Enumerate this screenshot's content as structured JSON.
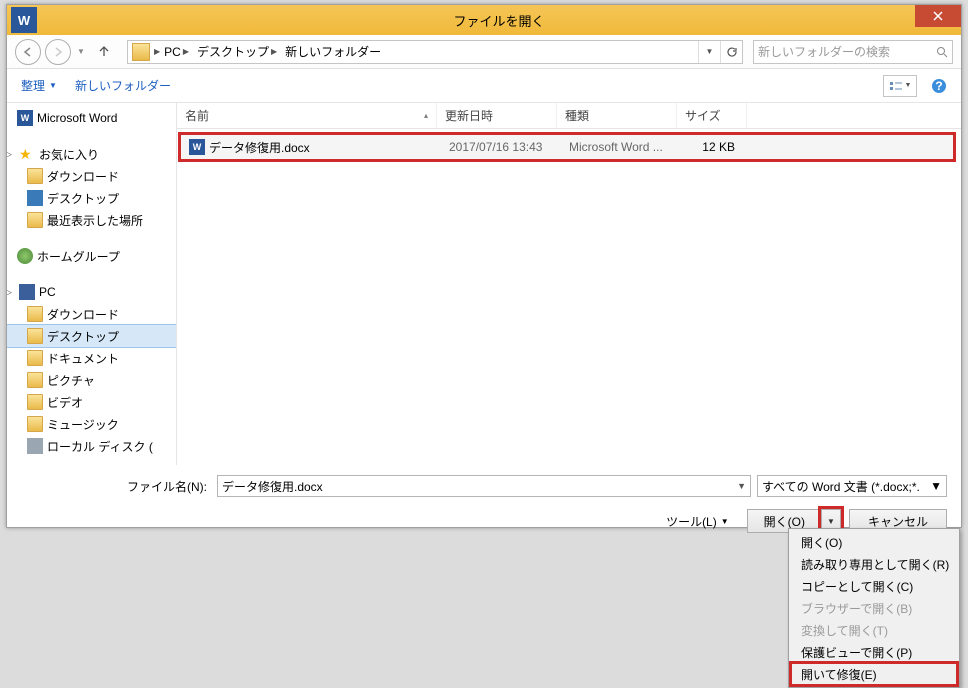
{
  "title": "ファイルを開く",
  "breadcrumb": [
    "PC",
    "デスクトップ",
    "新しいフォルダー"
  ],
  "search_placeholder": "新しいフォルダーの検索",
  "toolbar": {
    "organize": "整理",
    "new_folder": "新しいフォルダー"
  },
  "columns": {
    "name": "名前",
    "date": "更新日時",
    "type": "種類",
    "size": "サイズ"
  },
  "sidebar": {
    "word": "Microsoft Word",
    "fav": "お気に入り",
    "fav_items": [
      "ダウンロード",
      "デスクトップ",
      "最近表示した場所"
    ],
    "homegroup": "ホームグループ",
    "pc": "PC",
    "pc_items": [
      "ダウンロード",
      "デスクトップ",
      "ドキュメント",
      "ピクチャ",
      "ビデオ",
      "ミュージック",
      "ローカル ディスク ("
    ]
  },
  "file": {
    "name": "データ修復用.docx",
    "date": "2017/07/16 13:43",
    "type": "Microsoft Word ...",
    "size": "12 KB"
  },
  "footer": {
    "fn_label": "ファイル名(N):",
    "fn_value": "データ修復用.docx",
    "filter": "すべての Word 文書 (*.docx;*.",
    "tools": "ツール(L)",
    "open": "開く(O)",
    "cancel": "キャンセル"
  },
  "dropdown": [
    {
      "label": "開く(O)",
      "disabled": false
    },
    {
      "label": "読み取り専用として開く(R)",
      "disabled": false
    },
    {
      "label": "コピーとして開く(C)",
      "disabled": false
    },
    {
      "label": "ブラウザーで開く(B)",
      "disabled": true
    },
    {
      "label": "変換して開く(T)",
      "disabled": true
    },
    {
      "label": "保護ビューで開く(P)",
      "disabled": false
    },
    {
      "label": "開いて修復(E)",
      "disabled": false,
      "highlight": true
    }
  ]
}
